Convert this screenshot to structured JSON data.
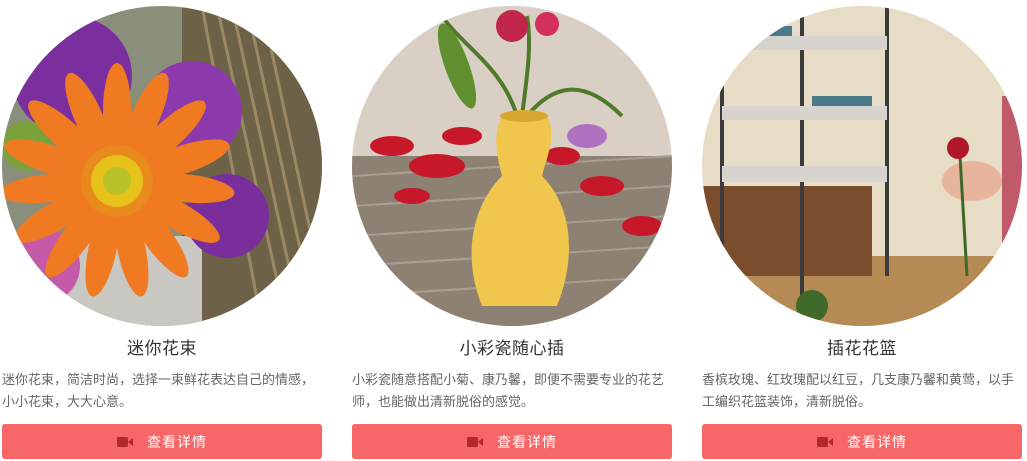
{
  "colors": {
    "button_bg": "#f76767",
    "button_icon": "#b3282a",
    "button_text": "#ffffff"
  },
  "cards": [
    {
      "title": "迷你花束",
      "desc": "迷你花束，简洁时尚，选择一束鲜花表达自己的情感，小小花束，大大心意。",
      "button_label": "查看详情",
      "image_subject": "orange-gerbera-bouquet",
      "icon": "video-camera-icon"
    },
    {
      "title": "小彩瓷随心插",
      "desc": "小彩瓷随意搭配小菊、康乃馨，即便不需要专业的花艺师，也能做出清新脱俗的感觉。",
      "button_label": "查看详情",
      "image_subject": "yellow-vase-with-flowers",
      "icon": "video-camera-icon"
    },
    {
      "title": "插花花篮",
      "desc": "香槟玫瑰、红玫瑰配以红豆，几支康乃馨和黄莺，以手工编织花篮装饰，清新脱俗。",
      "button_label": "查看详情",
      "image_subject": "hand-holding-rose-in-shop",
      "icon": "video-camera-icon"
    }
  ]
}
